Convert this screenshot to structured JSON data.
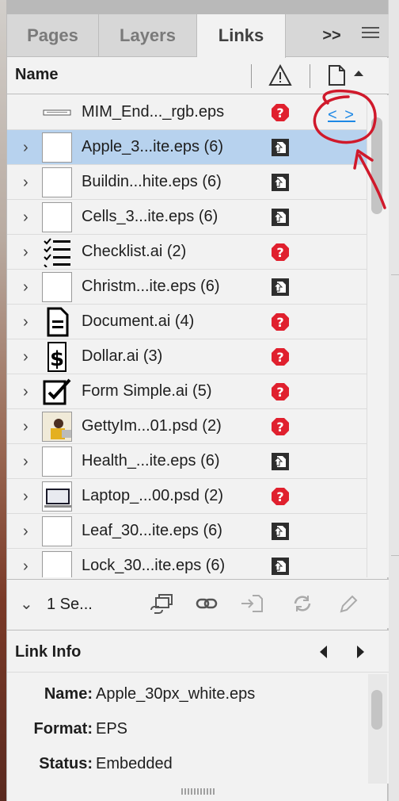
{
  "tabs": [
    {
      "label": "Pages"
    },
    {
      "label": "Layers"
    },
    {
      "label": "Links"
    }
  ],
  "tab_overflow": ">>",
  "column_header": {
    "name_label": "Name"
  },
  "links": [
    {
      "label": "MIM_End..._rgb.eps",
      "status": "missing",
      "thumb": "bar",
      "expandable": false,
      "selected": false
    },
    {
      "label": "Apple_3...ite.eps (6)",
      "status": "embedded",
      "thumb": "blank",
      "expandable": true,
      "selected": true
    },
    {
      "label": "Buildin...hite.eps (6)",
      "status": "embedded",
      "thumb": "blank",
      "expandable": true,
      "selected": false
    },
    {
      "label": "Cells_3...ite.eps (6)",
      "status": "embedded",
      "thumb": "blank",
      "expandable": true,
      "selected": false
    },
    {
      "label": "Checklist.ai (2)",
      "status": "missing",
      "thumb": "checklist",
      "expandable": true,
      "selected": false
    },
    {
      "label": "Christm...ite.eps (6)",
      "status": "embedded",
      "thumb": "blank",
      "expandable": true,
      "selected": false
    },
    {
      "label": "Document.ai (4)",
      "status": "missing",
      "thumb": "document",
      "expandable": true,
      "selected": false
    },
    {
      "label": "Dollar.ai (3)",
      "status": "missing",
      "thumb": "dollar",
      "expandable": true,
      "selected": false
    },
    {
      "label": "Form Simple.ai (5)",
      "status": "missing",
      "thumb": "form",
      "expandable": true,
      "selected": false
    },
    {
      "label": "GettyIm...01.psd (2)",
      "status": "missing",
      "thumb": "photo",
      "expandable": true,
      "selected": false
    },
    {
      "label": "Health_...ite.eps (6)",
      "status": "embedded",
      "thumb": "blank",
      "expandable": true,
      "selected": false
    },
    {
      "label": "Laptop_...00.psd (2)",
      "status": "missing",
      "thumb": "laptop",
      "expandable": true,
      "selected": false
    },
    {
      "label": "Leaf_30...ite.eps (6)",
      "status": "embedded",
      "thumb": "blank",
      "expandable": true,
      "selected": false
    },
    {
      "label": "Lock_30...ite.eps (6)",
      "status": "embedded",
      "thumb": "blank",
      "expandable": true,
      "selected": false
    }
  ],
  "toolbar": {
    "selection_label": "1 Se...",
    "buttons": [
      "relink-from-cc-icon",
      "relink-icon",
      "goto-link-icon",
      "update-link-icon",
      "edit-original-icon"
    ]
  },
  "link_info": {
    "title": "Link Info",
    "fields": [
      {
        "key": "Name:",
        "value": "Apple_30px_white.eps"
      },
      {
        "key": "Format:",
        "value": "EPS"
      },
      {
        "key": "Status:",
        "value": "Embedded"
      }
    ]
  },
  "annotation": {
    "link_text": "< >",
    "color": "#d0192b"
  },
  "colors": {
    "selected_row": "#b7d2ee",
    "missing_red": "#e0202e",
    "link_blue": "#1e88e5"
  }
}
